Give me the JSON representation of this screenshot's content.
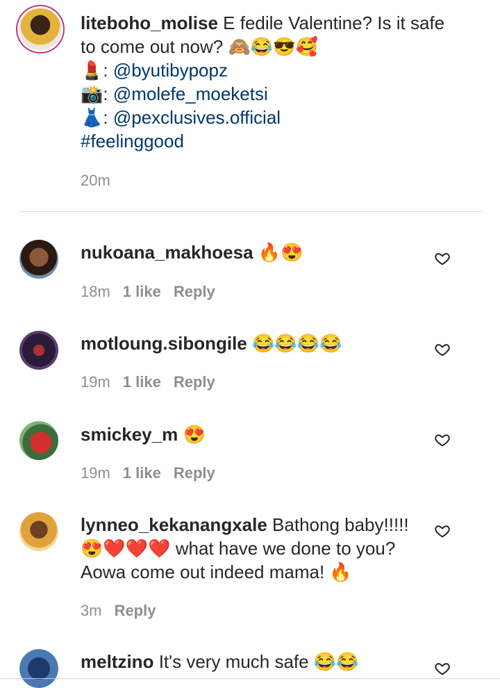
{
  "post": {
    "username": "liteboho_molise",
    "caption_line1": "E fedile Valentine? Is it safe",
    "caption_line2": "to come out now? 🙈😂😎🥰",
    "credit1_emoji": "💄",
    "credit1": "@byutibypopz",
    "credit2_emoji": "📸",
    "credit2": "@molefe_moeketsi",
    "credit3_emoji": "👗",
    "credit3": "@pexclusives.official",
    "hashtag": "#feelinggood",
    "time": "20m"
  },
  "comments": [
    {
      "username": "nukoana_makhoesa",
      "text": "🔥😍",
      "time": "18m",
      "likes": "1 like",
      "reply": "Reply"
    },
    {
      "username": "motloung.sibongile",
      "text": "😂😂😂😂",
      "time": "19m",
      "likes": "1 like",
      "reply": "Reply"
    },
    {
      "username": "smickey_m",
      "text": "😍",
      "time": "19m",
      "likes": "1 like",
      "reply": "Reply"
    },
    {
      "username": "lynneo_kekanangxale",
      "text": "Bathong baby!!!!!",
      "line2": "😍❤️❤️❤️ what have we done to you?",
      "line3": "Aowa come out indeed mama! 🔥",
      "time": "3m",
      "reply": "Reply"
    },
    {
      "username": "meltzino",
      "text": "It's very much safe 😂😂"
    }
  ],
  "colors": {
    "link": "#00376b",
    "meta": "#8e8e8e",
    "ring": "#c13584"
  },
  "icons": {
    "like": "heart-outline-icon"
  }
}
